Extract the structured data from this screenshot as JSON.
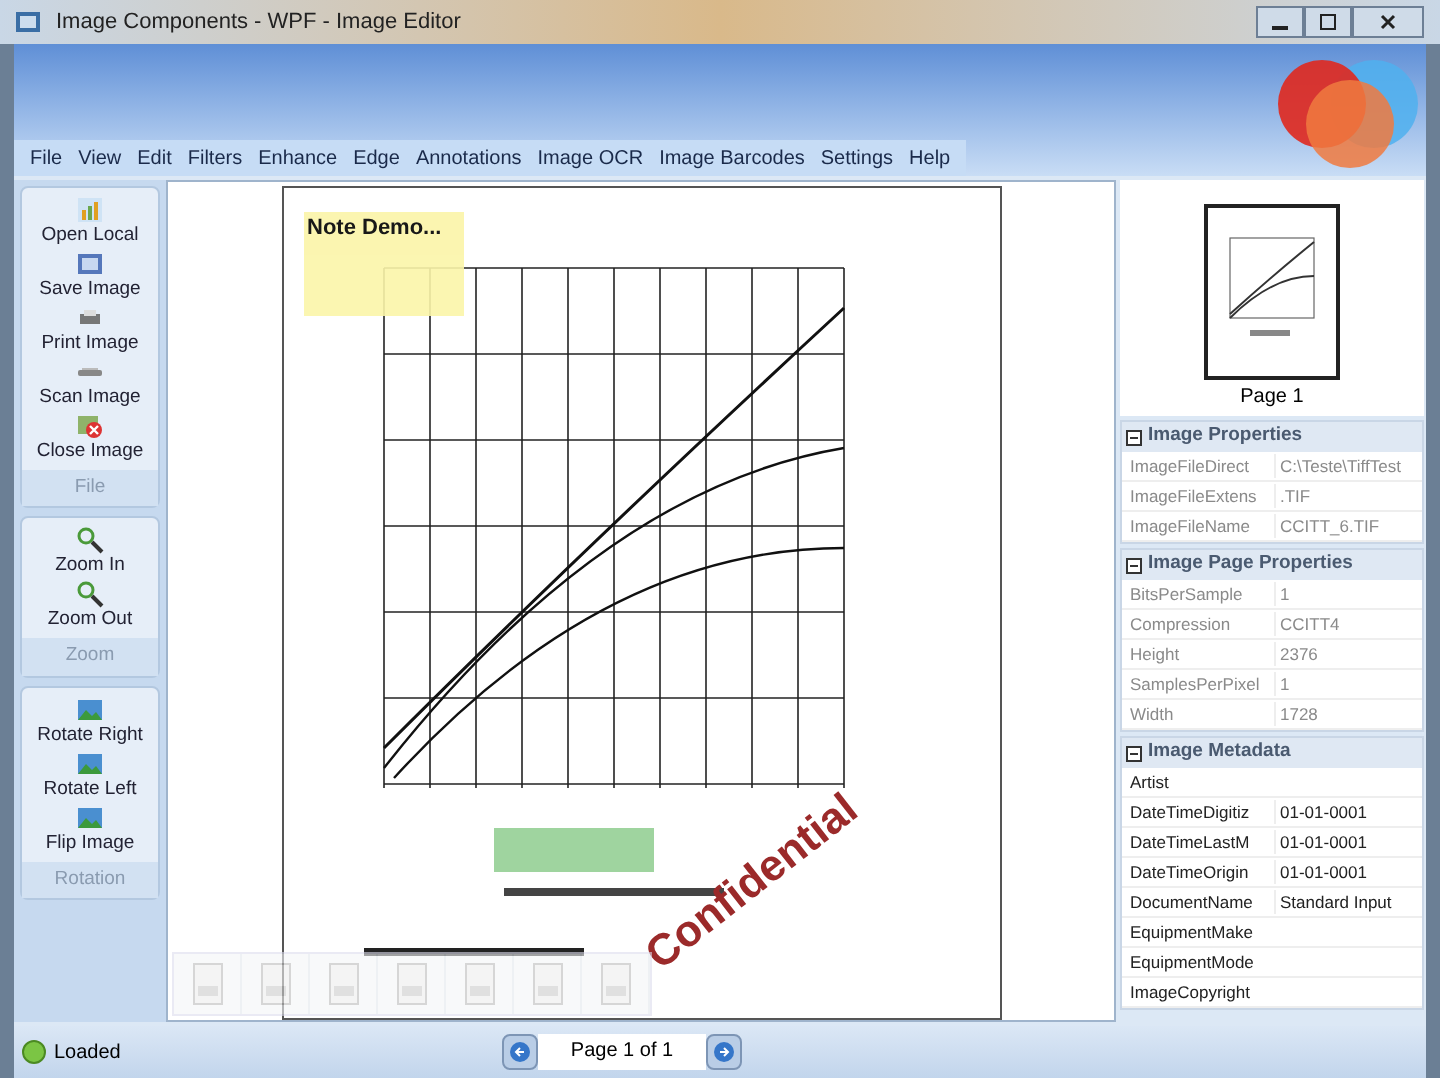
{
  "window": {
    "title": "Image Components - WPF - Image Editor"
  },
  "menu": [
    "File",
    "View",
    "Edit",
    "Filters",
    "Enhance",
    "Edge",
    "Annotations",
    "Image OCR",
    "Image Barcodes",
    "Settings",
    "Help"
  ],
  "groups": [
    {
      "title": "File",
      "items": [
        {
          "label": "Open Local",
          "kind": "open"
        },
        {
          "label": "Save Image",
          "kind": "save"
        },
        {
          "label": "Print Image",
          "kind": "print"
        },
        {
          "label": "Scan Image",
          "kind": "scan"
        },
        {
          "label": "Close Image",
          "kind": "close"
        }
      ]
    },
    {
      "title": "Zoom",
      "items": [
        {
          "label": "Zoom In",
          "kind": "zoom"
        },
        {
          "label": "Zoom Out",
          "kind": "zoom"
        }
      ]
    },
    {
      "title": "Rotation",
      "items": [
        {
          "label": "Rotate Right",
          "kind": "rotate"
        },
        {
          "label": "Rotate Left",
          "kind": "rotate"
        },
        {
          "label": "Flip Image",
          "kind": "rotate"
        }
      ]
    }
  ],
  "document": {
    "note": "Note Demo...",
    "stamp": "Confidential"
  },
  "thumbnail": {
    "label": "Page 1"
  },
  "property_sections": [
    {
      "title": "Image Properties",
      "disabled": true,
      "rows": [
        {
          "name": "ImageFileDirect",
          "value": "C:\\Teste\\TiffTest"
        },
        {
          "name": "ImageFileExtens",
          "value": ".TIF"
        },
        {
          "name": "ImageFileName",
          "value": "CCITT_6.TIF"
        }
      ]
    },
    {
      "title": "Image Page Properties",
      "disabled": true,
      "rows": [
        {
          "name": "BitsPerSample",
          "value": "1"
        },
        {
          "name": "Compression",
          "value": "CCITT4"
        },
        {
          "name": "Height",
          "value": "2376"
        },
        {
          "name": "SamplesPerPixel",
          "value": "1"
        },
        {
          "name": "Width",
          "value": "1728"
        }
      ]
    },
    {
      "title": "Image Metadata",
      "disabled": false,
      "rows": [
        {
          "name": "Artist",
          "value": ""
        },
        {
          "name": "DateTimeDigitiz",
          "value": "01-01-0001"
        },
        {
          "name": "DateTimeLastM",
          "value": "01-01-0001"
        },
        {
          "name": "DateTimeOrigin",
          "value": "01-01-0001"
        },
        {
          "name": "DocumentName",
          "value": "Standard Input"
        },
        {
          "name": "EquipmentMake",
          "value": ""
        },
        {
          "name": "EquipmentMode",
          "value": ""
        },
        {
          "name": "ImageCopyright",
          "value": ""
        }
      ]
    }
  ],
  "status_bar": {
    "text": "Loaded",
    "page": "Page 1 of 1"
  }
}
